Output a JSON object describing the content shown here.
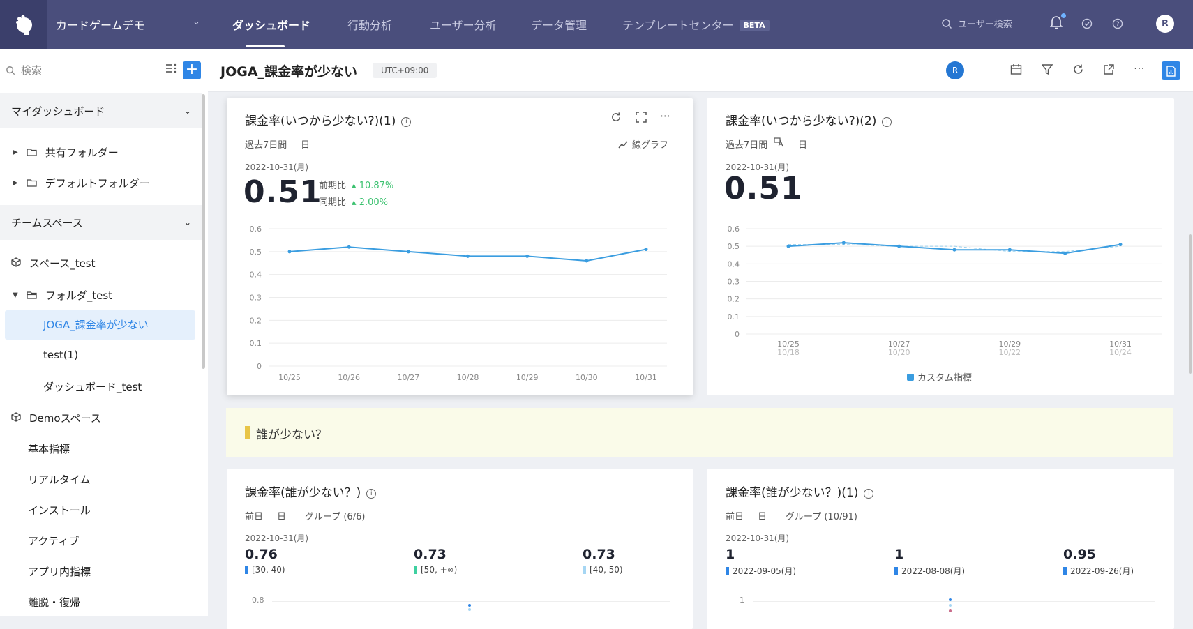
{
  "app": {
    "name": "カードゲームデモ",
    "user_initial": "R"
  },
  "nav": {
    "items": [
      "ダッシュボード",
      "行動分析",
      "ユーザー分析",
      "データ管理",
      "テンプレートセンター"
    ],
    "beta": "BETA",
    "user_search": "ユーザー検索"
  },
  "sidebar": {
    "search_placeholder": "検索",
    "my_dashboard": "マイダッシュボード",
    "shared_folder": "共有フォルダー",
    "default_folder": "デフォルトフォルダー",
    "team_space": "チームスペース",
    "space_test": "スペース_test",
    "folder_test": "フォルダ_test",
    "selected": "JOGA_課金率が少ない",
    "test1": "test(1)",
    "dashboard_test": "ダッシュボード_test",
    "demo_space": "Demoスペース",
    "demo_items": [
      "基本指標",
      "リアルタイム",
      "インストール",
      "アクティブ",
      "アプリ内指標",
      "離脱・復帰"
    ]
  },
  "header": {
    "title": "JOGA_課金率が少ない",
    "timezone": "UTC+09:00",
    "avatar": "R"
  },
  "cards": {
    "c1": {
      "title": "課金率(いつから少ない?)(1)",
      "period": "過去7日間",
      "unit": "日",
      "chart_type_label": "線グラフ",
      "date": "2022-10-31(月)",
      "value": "0.51",
      "prev_label": "前期比",
      "prev_value": "10.87%",
      "yoy_label": "同期比",
      "yoy_value": "2.00%"
    },
    "c2": {
      "title": "課金率(いつから少ない?)(2)",
      "period": "過去7日間",
      "unit": "日",
      "date": "2022-10-31(月)",
      "value": "0.51",
      "legend": "カスタム指標"
    },
    "banner": "誰が少ない？",
    "c3": {
      "title": "課金率(誰が少ない？)",
      "period": "前日",
      "unit": "日",
      "group": "グループ (6/6)",
      "date": "2022-10-31(月)",
      "items": [
        {
          "value": "0.76",
          "label": "[30, 40)",
          "color": "#2f86e6"
        },
        {
          "value": "0.73",
          "label": "[50, +∞)",
          "color": "#3ed0a0"
        },
        {
          "value": "0.73",
          "label": "[40, 50)",
          "color": "#a6d6f3"
        }
      ],
      "ytick": "0.8"
    },
    "c4": {
      "title": "課金率(誰が少ない？)(1)",
      "period": "前日",
      "unit": "日",
      "group": "グループ (10/91)",
      "date": "2022-10-31(月)",
      "items": [
        {
          "value": "1",
          "label": "2022-09-05(月)",
          "color": "#2f86e6"
        },
        {
          "value": "1",
          "label": "2022-08-08(月)",
          "color": "#2f86e6"
        },
        {
          "value": "0.95",
          "label": "2022-09-26(月)",
          "color": "#2f86e6"
        }
      ],
      "ytick": "1"
    }
  },
  "chart_data": [
    {
      "type": "line",
      "categories": [
        "10/25",
        "10/26",
        "10/27",
        "10/28",
        "10/29",
        "10/30",
        "10/31"
      ],
      "values": [
        0.5,
        0.52,
        0.5,
        0.48,
        0.48,
        0.46,
        0.51
      ],
      "yticks": [
        "0",
        "0.1",
        "0.2",
        "0.3",
        "0.4",
        "0.5",
        "0.6"
      ],
      "ylim": [
        0,
        0.6
      ],
      "color": "#3a9de0"
    },
    {
      "type": "line",
      "x": [
        "10/25",
        "10/26",
        "10/27",
        "10/28",
        "10/29",
        "10/30",
        "10/31"
      ],
      "xlabels": [
        "10/25",
        "10/27",
        "10/29",
        "10/31"
      ],
      "xlabels_compare": [
        "10/18",
        "10/20",
        "10/22",
        "10/24"
      ],
      "series": [
        {
          "name": "カスタム指標",
          "values": [
            0.5,
            0.52,
            0.5,
            0.48,
            0.48,
            0.46,
            0.51
          ],
          "color": "#3a9de0"
        },
        {
          "values": [
            0.51,
            0.51,
            0.5,
            0.5,
            0.47,
            0.47,
            0.5
          ],
          "dashed": true,
          "color": "#9ad0ee"
        }
      ],
      "yticks": [
        "0",
        "0.1",
        "0.2",
        "0.3",
        "0.4",
        "0.5",
        "0.6"
      ],
      "ylim": [
        0,
        0.6
      ]
    }
  ]
}
